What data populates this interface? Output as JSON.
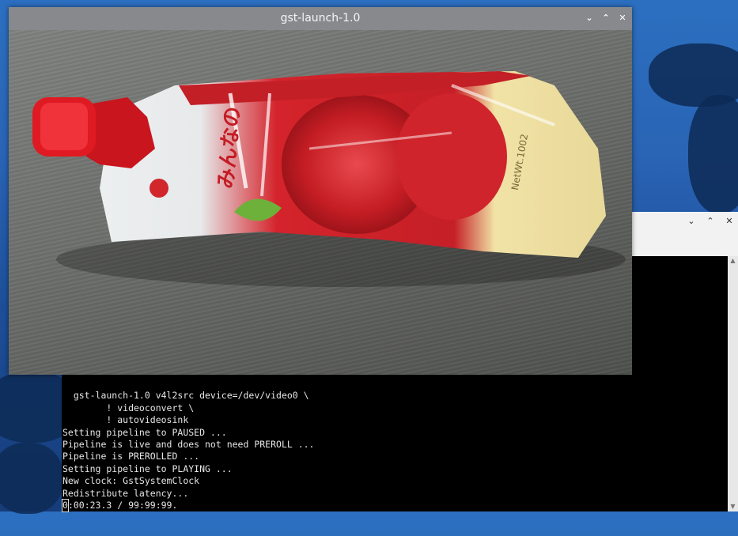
{
  "gst_window": {
    "title": "gst-launch-1.0",
    "controls": {
      "minimize": "⌄",
      "maximize": "⌃",
      "close": "✕"
    },
    "video": {
      "pouch_text_1": "みんなの",
      "pouch_text_2": "NetWt.1002"
    }
  },
  "terminal": {
    "controls": {
      "minimize": "⌄",
      "maximize": "⌃",
      "close": "✕"
    },
    "lines": [
      "  gst-launch-1.0 v4l2src device=/dev/video0 \\",
      "        ! videoconvert \\",
      "        ! autovideosink",
      "Setting pipeline to PAUSED ...",
      "Pipeline is live and does not need PREROLL ...",
      "Pipeline is PREROLLED ...",
      "Setting pipeline to PLAYING ...",
      "New clock: GstSystemClock",
      "Redistribute latency..."
    ],
    "progress_cursor_char": "0",
    "progress_rest": ":00:23.3 / 99:99:99."
  },
  "colors": {
    "desktop_blue": "#2a64b5",
    "titlebar_gray": "#87898d",
    "terminal_bg": "#000000",
    "pouch_red": "#d8232a"
  },
  "icons": [
    "chevron-down-icon",
    "chevron-up-icon",
    "close-icon",
    "scroll-up-icon",
    "scroll-down-icon"
  ]
}
